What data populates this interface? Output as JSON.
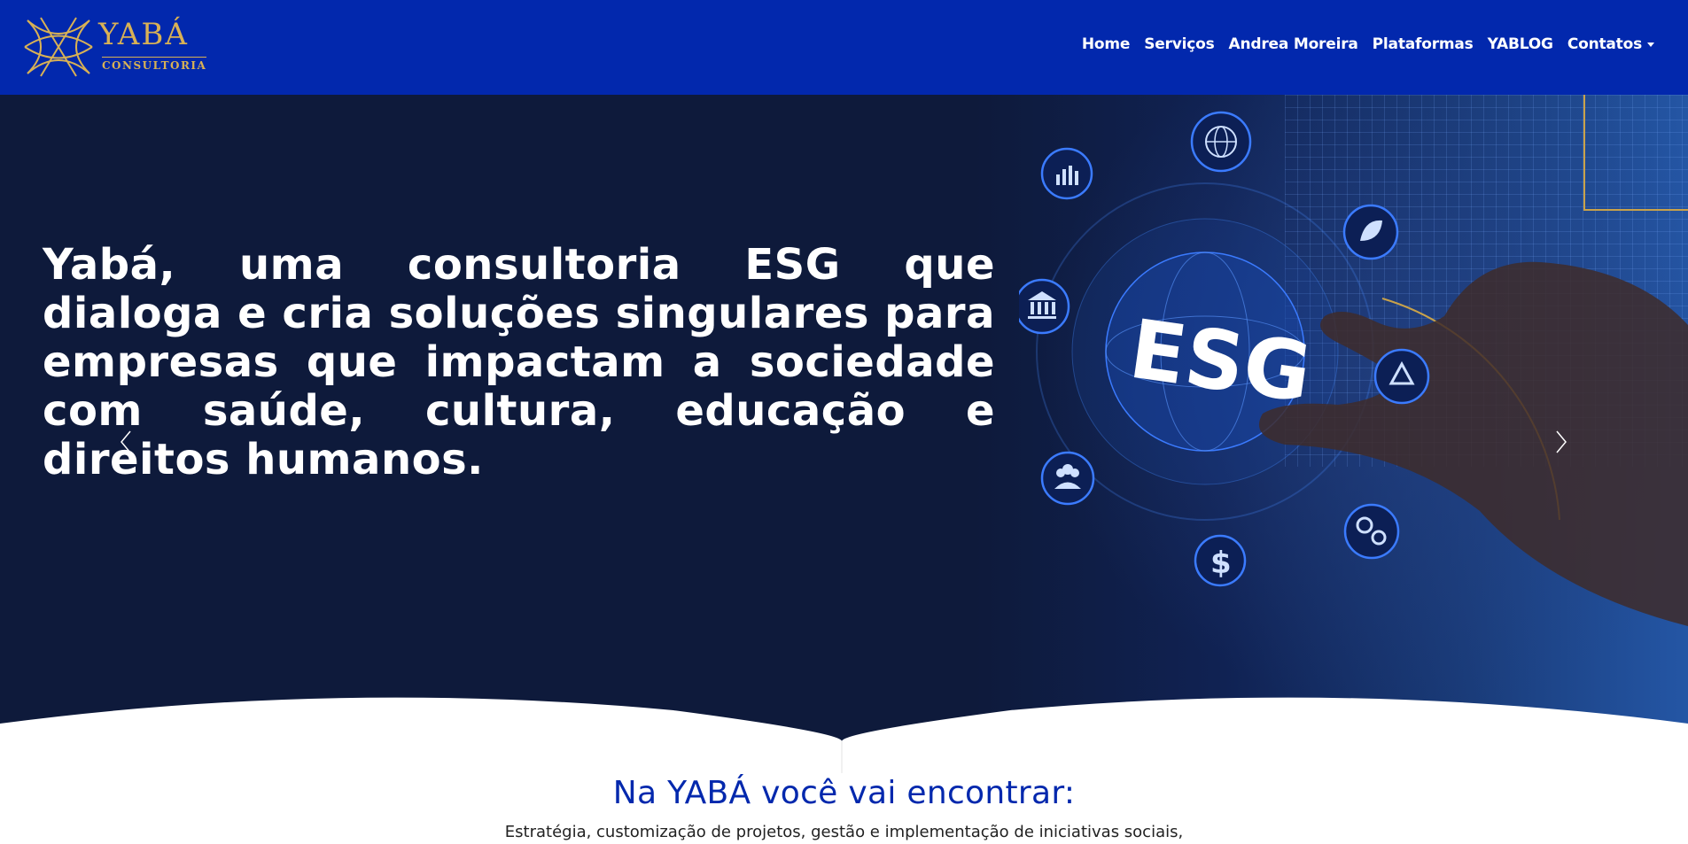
{
  "brand": {
    "name": "YABÁ",
    "tagline": "CONSULTORIA",
    "colors": {
      "navbar": "#0228ad",
      "gold": "#d8b155",
      "hero_bg": "#0e1a3b",
      "section_title": "#0228ad"
    }
  },
  "nav": {
    "items": [
      {
        "label": "Home"
      },
      {
        "label": "Serviços"
      },
      {
        "label": "Andrea Moreira"
      },
      {
        "label": "Plataformas"
      },
      {
        "label": "YABLOG"
      },
      {
        "label": "Contatos",
        "dropdown": true
      }
    ]
  },
  "hero": {
    "headline": "Yabá, uma consultoria ESG que dialoga e cria soluções singulares para empresas que impactam a sociedade com saúde, cultura, educação e direitos humanos.",
    "image_text": "ESG",
    "icons": [
      "globe-icon",
      "bar-chart-icon",
      "leaf-icon",
      "bank-icon",
      "recycle-icon",
      "people-icon",
      "gears-icon",
      "dollar-icon"
    ],
    "prev_icon": "chevron-left-icon",
    "next_icon": "chevron-right-icon"
  },
  "section": {
    "title": "Na YABÁ você vai encontrar:",
    "text": "Estratégia, customização de projetos, gestão e implementação de iniciativas sociais,"
  }
}
